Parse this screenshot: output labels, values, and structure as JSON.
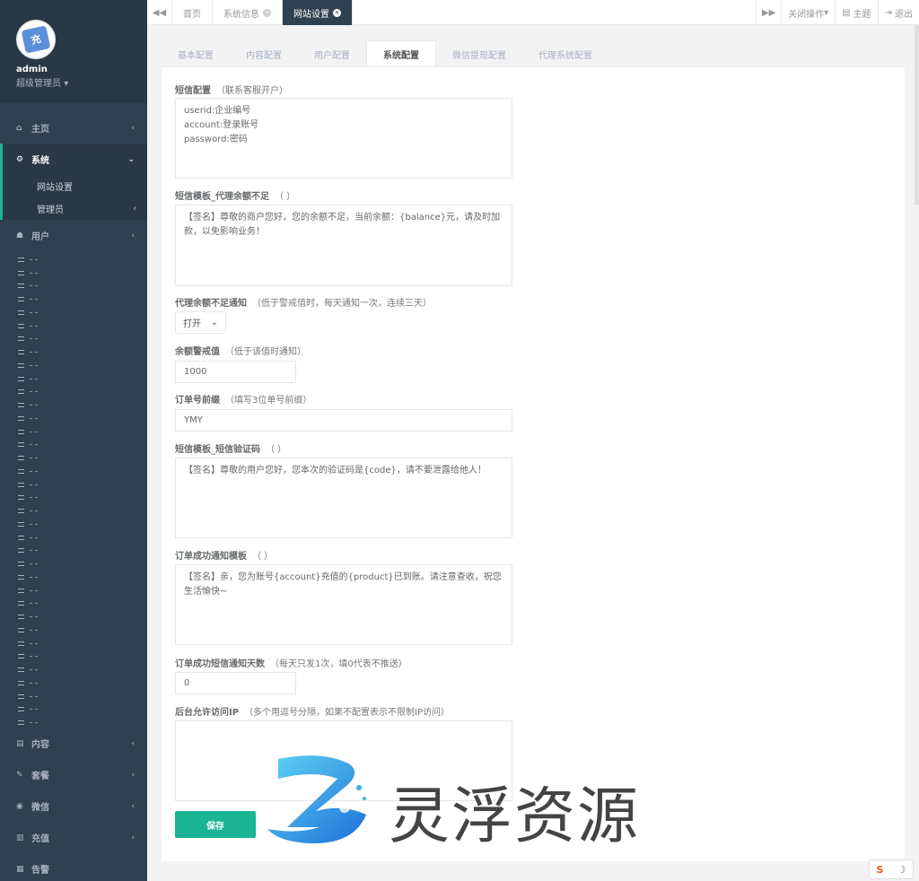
{
  "sidebar": {
    "avatar_text": "充",
    "username": "admin",
    "role": "超级管理员",
    "items": {
      "home": "主页",
      "system": "系统",
      "site_settings": "网站设置",
      "admins": "管理员",
      "users": "用户",
      "content": "内容",
      "package": "套餐",
      "wechat": "微信",
      "recharge": "充值",
      "alarm": "告警"
    },
    "placeholder_rows": 36
  },
  "topbar": {
    "tabs": [
      "首页",
      "系统信息",
      "网站设置"
    ],
    "close_ops": "关闭操作",
    "theme": "主题",
    "logout": "退出"
  },
  "config_tabs": [
    "基本配置",
    "内容配置",
    "用户配置",
    "系统配置",
    "微信提现配置",
    "代理系统配置"
  ],
  "form": {
    "sms_config": {
      "label": "短信配置",
      "hint": "（联系客服开户）",
      "value": "userid:企业编号\naccount:登录账号\npassword:密码"
    },
    "sms_low_balance": {
      "label": "短信模板_代理余额不足",
      "hint": "（ ）",
      "value": "【签名】尊敬的商户您好，您的余额不足，当前余额：{balance}元，请及时加款，以免影响业务！"
    },
    "low_balance_notice": {
      "label": "代理余额不足通知",
      "hint": "（低于警戒值时，每天通知一次，连续三天）",
      "value": "打开"
    },
    "balance_alert": {
      "label": "余额警戒值",
      "hint": "（低于该值时通知）",
      "value": "1000"
    },
    "order_prefix": {
      "label": "订单号前缀",
      "hint": "（填写3位单号前缀）",
      "value": "YMY"
    },
    "sms_code": {
      "label": "短信模板_短信验证码",
      "hint": "（ ）",
      "value": "【签名】尊敬的用户您好，您本次的验证码是{code}，请不要泄露给他人！"
    },
    "order_success_tpl": {
      "label": "订单成功通知模板",
      "hint": "（ ）",
      "value": "【签名】亲，您为账号{account}充值的{product}已到账。请注意查收，祝您生活愉快~"
    },
    "order_success_days": {
      "label": "订单成功短信通知天数",
      "hint": "（每天只发1次，填0代表不推送）",
      "value": "0"
    },
    "allowed_ip": {
      "label": "后台允许访问IP",
      "hint": "（多个用逗号分隔，如果不配置表示不限制IP访问）",
      "value": ""
    },
    "save_label": "保存"
  },
  "watermark": "灵浮资源",
  "colors": {
    "sidebar": "#2f4050",
    "accent": "#1ab394"
  }
}
